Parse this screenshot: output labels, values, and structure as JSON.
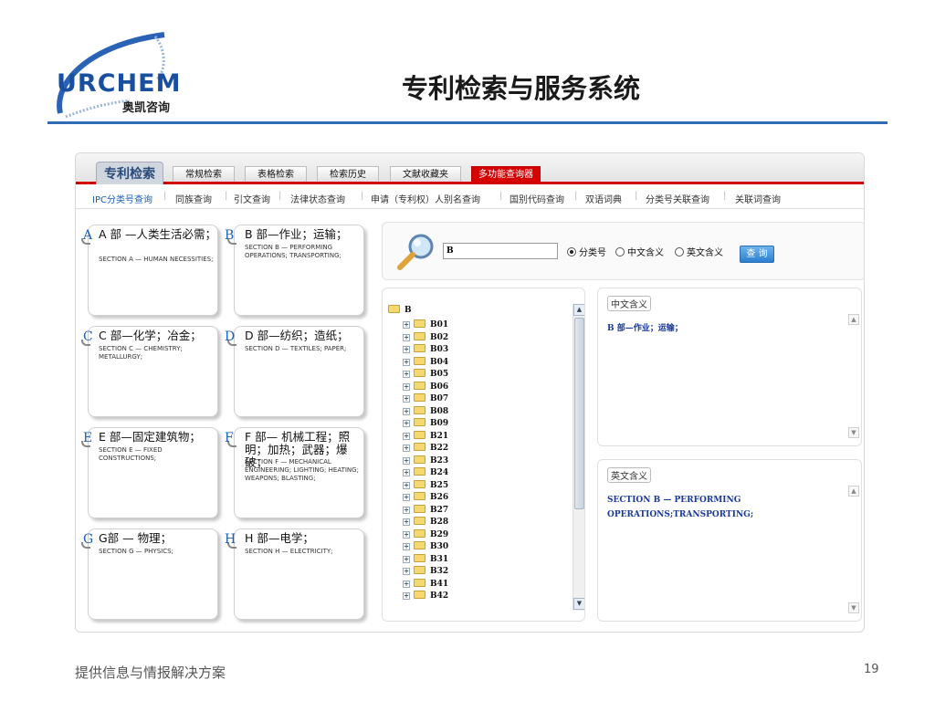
{
  "slide": {
    "title": "专利检索与服务系统",
    "footer": "提供信息与情报解决方案",
    "page_number": "19"
  },
  "logo": {
    "wordmark": "URCHEM",
    "subtitle": "奥凯咨询"
  },
  "app": {
    "brand_tab": "专利检索",
    "tabs": [
      {
        "label": "常规检索"
      },
      {
        "label": "表格检索"
      },
      {
        "label": "检索历史"
      },
      {
        "label": "文献收藏夹"
      },
      {
        "label": "多功能查询器"
      }
    ],
    "subnav": [
      {
        "label": "IPC分类号查询"
      },
      {
        "label": "同族查询"
      },
      {
        "label": "引文查询"
      },
      {
        "label": "法律状态查询"
      },
      {
        "label": "申请（专利权）人别名查询"
      },
      {
        "label": "国别代码查询"
      },
      {
        "label": "双语词典"
      },
      {
        "label": "分类号关联查询"
      },
      {
        "label": "关联词查询"
      }
    ],
    "sections": [
      {
        "letter": "A",
        "zh": "A 部 —人类生活必需；",
        "en": "SECTION A — HUMAN NECESSITIES;"
      },
      {
        "letter": "B",
        "zh": "B 部—作业；运输；",
        "en": "SECTION B — PERFORMING OPERATIONS; TRANSPORTING;"
      },
      {
        "letter": "C",
        "zh": "C 部—化学；冶金；",
        "en": "SECTION C — CHEMISTRY; METALLURGY;"
      },
      {
        "letter": "D",
        "zh": "D 部—纺织；造纸；",
        "en": "SECTION D — TEXTILES; PAPER;"
      },
      {
        "letter": "E",
        "zh": "E 部—固定建筑物；",
        "en": "SECTION E — FIXED CONSTRUCTIONS;"
      },
      {
        "letter": "F",
        "zh": "F 部— 机械工程；照明；加热；武器；爆破；",
        "en": "SECTION F — MECHANICAL ENGINEERING; LIGHTING; HEATING; WEAPONS; BLASTING;"
      },
      {
        "letter": "G",
        "zh": "G部 — 物理；",
        "en": "SECTION G — PHYSICS;"
      },
      {
        "letter": "H",
        "zh": "H 部—电学；",
        "en": "SECTION H — ELECTRICITY;"
      }
    ],
    "search": {
      "value": "B",
      "options": [
        {
          "label": "分类号",
          "selected": true
        },
        {
          "label": "中文含义",
          "selected": false
        },
        {
          "label": "英文含义",
          "selected": false
        }
      ],
      "button": "查 询"
    },
    "tree": {
      "root": "B",
      "items": [
        "B01",
        "B02",
        "B03",
        "B04",
        "B05",
        "B06",
        "B07",
        "B08",
        "B09",
        "B21",
        "B22",
        "B23",
        "B24",
        "B25",
        "B26",
        "B27",
        "B28",
        "B29",
        "B30",
        "B31",
        "B32",
        "B41",
        "B42"
      ]
    },
    "zh_meaning": {
      "label": "中文含义",
      "text": "B 部—作业；运输；"
    },
    "en_meaning": {
      "label": "英文含义",
      "text": "SECTION B — PERFORMING OPERATIONS;TRANSPORTING;"
    }
  }
}
